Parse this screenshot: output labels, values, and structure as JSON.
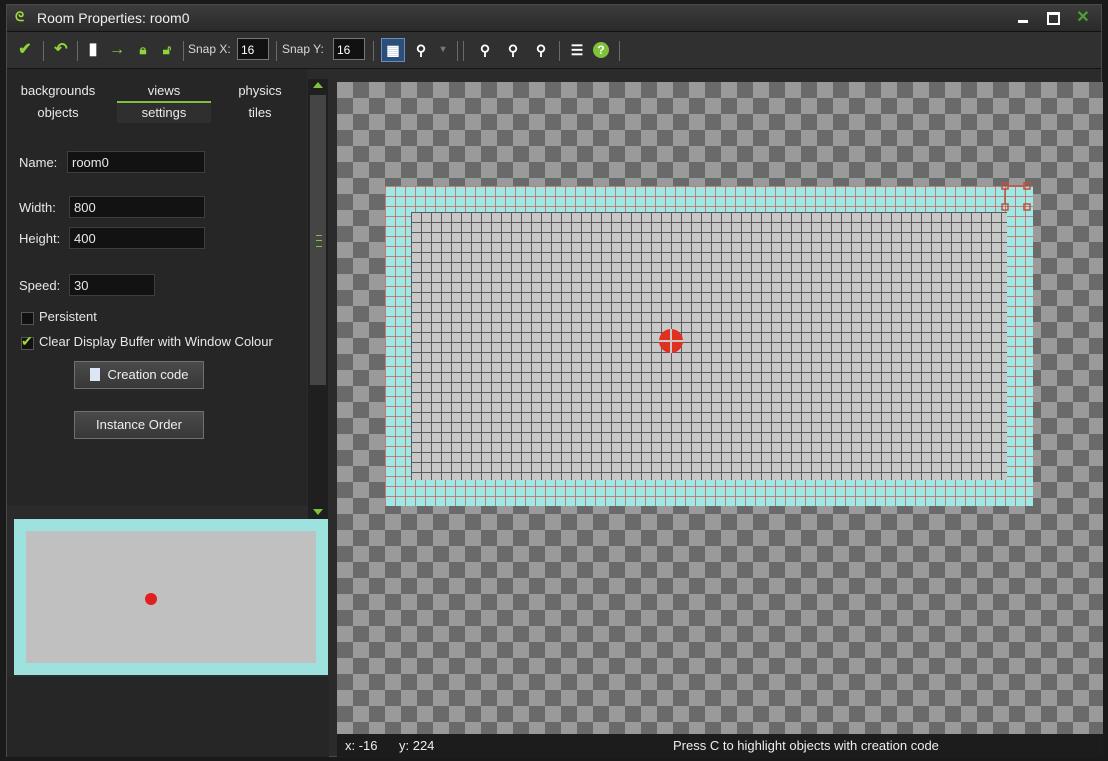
{
  "window": {
    "title": "Room Properties: room0"
  },
  "toolbar": {
    "snap_x_label": "Snap X:",
    "snap_x_value": "16",
    "snap_y_label": "Snap Y:",
    "snap_y_value": "16"
  },
  "tabs": [
    {
      "label": "backgrounds"
    },
    {
      "label": "views"
    },
    {
      "label": "physics"
    },
    {
      "label": "objects"
    },
    {
      "label": "settings"
    },
    {
      "label": "tiles"
    }
  ],
  "settings": {
    "name_label": "Name:",
    "name_value": "room0",
    "width_label": "Width:",
    "width_value": "800",
    "height_label": "Height:",
    "height_value": "400",
    "speed_label": "Speed:",
    "speed_value": "30",
    "persistent_label": "Persistent",
    "clear_buffer_label": "Clear Display Buffer with Window Colour",
    "creation_code_label": "Creation code",
    "instance_order_label": "Instance Order"
  },
  "status": {
    "x": "x: -16",
    "y": "y: 224",
    "hint": "Press C to highlight objects with creation code"
  },
  "colors": {
    "accent": "#7fc23a",
    "room_border": "#9ee8e6",
    "object": "#e03020"
  }
}
